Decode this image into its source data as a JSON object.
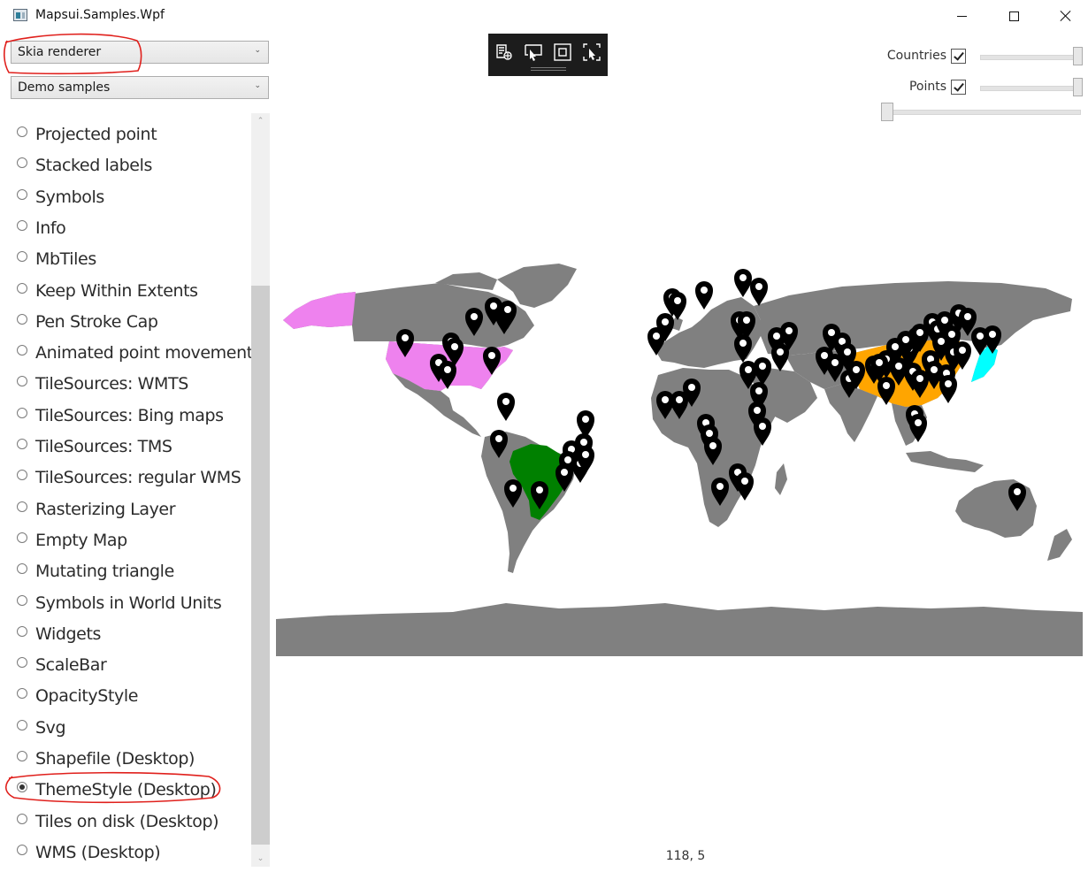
{
  "window": {
    "title": "Mapsui.Samples.Wpf"
  },
  "renderer_select": {
    "value": "Skia renderer"
  },
  "category_select": {
    "value": "Demo samples"
  },
  "samples": [
    {
      "label": "Projected point",
      "selected": false
    },
    {
      "label": "Stacked labels",
      "selected": false
    },
    {
      "label": "Symbols",
      "selected": false
    },
    {
      "label": "Info",
      "selected": false
    },
    {
      "label": "MbTiles",
      "selected": false
    },
    {
      "label": "Keep Within Extents",
      "selected": false
    },
    {
      "label": "Pen Stroke Cap",
      "selected": false
    },
    {
      "label": "Animated point movement",
      "selected": false
    },
    {
      "label": "TileSources: WMTS",
      "selected": false
    },
    {
      "label": "TileSources: Bing maps",
      "selected": false
    },
    {
      "label": "TileSources: TMS",
      "selected": false
    },
    {
      "label": "TileSources: regular WMS",
      "selected": false
    },
    {
      "label": "Rasterizing Layer",
      "selected": false
    },
    {
      "label": "Empty Map",
      "selected": false
    },
    {
      "label": "Mutating triangle",
      "selected": false
    },
    {
      "label": "Symbols in World Units",
      "selected": false
    },
    {
      "label": "Widgets",
      "selected": false
    },
    {
      "label": "ScaleBar",
      "selected": false
    },
    {
      "label": "OpacityStyle",
      "selected": false
    },
    {
      "label": "Svg",
      "selected": false
    },
    {
      "label": "Shapefile (Desktop)",
      "selected": false
    },
    {
      "label": "ThemeStyle (Desktop)",
      "selected": true
    },
    {
      "label": "Tiles on disk (Desktop)",
      "selected": false
    },
    {
      "label": "WMS (Desktop)",
      "selected": false
    }
  ],
  "toolbar": {
    "icons": [
      "zoom-to-layer-icon",
      "select-pointer-icon",
      "zoom-box-icon",
      "pan-select-icon"
    ]
  },
  "layers": [
    {
      "name": "Countries",
      "checked": true,
      "opacity": 1.0
    },
    {
      "name": "Points",
      "checked": true,
      "opacity": 1.0
    }
  ],
  "zoom_slider": {
    "value": 0
  },
  "map": {
    "land_color": "#808080",
    "highlight_colors": {
      "united_states": "#ee82ee",
      "brazil": "#008000",
      "china": "#ffa500",
      "japan": "#00ffff"
    },
    "marker_color": "#000000"
  },
  "status": {
    "coordinates": "118, 5"
  },
  "annotation_color": "#e0201c"
}
